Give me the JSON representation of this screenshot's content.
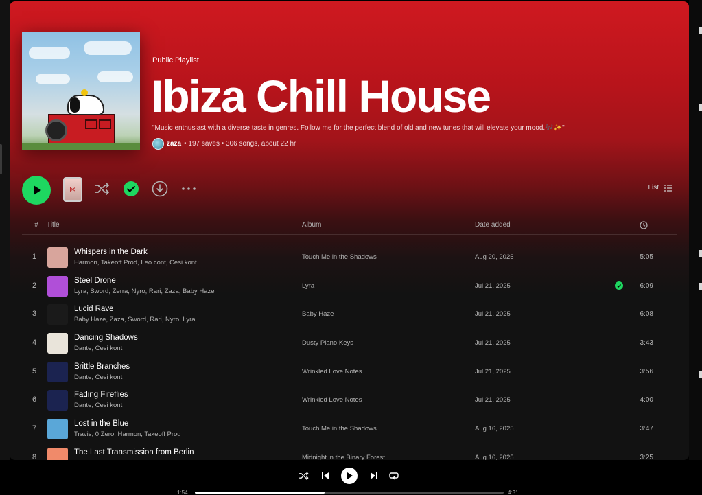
{
  "playlist": {
    "type_label": "Public Playlist",
    "title": "Ibiza Chill House",
    "description": "\"Music enthusiast with a diverse taste in genres. Follow me for the perfect blend of old and new tunes that will elevate your mood.🎶✨\"",
    "owner": "zaza",
    "stats": "• 197 saves • 306 songs, about 22 hr"
  },
  "actions": {
    "play_icon": "play-icon",
    "shuffle_icon": "shuffle-icon",
    "saved_icon": "check-circle-icon",
    "download_icon": "download-icon",
    "more_icon": "more-dots-icon",
    "view_label": "List"
  },
  "table": {
    "headers": {
      "num": "#",
      "title": "Title",
      "album": "Album",
      "date": "Date added",
      "duration_icon": "clock-icon"
    },
    "rows": [
      {
        "num": "1",
        "title": "Whispers in the Dark",
        "artists": "Harmon, Takeoff Prod, Leo cont, Cesi kont",
        "album": "Touch Me in the Shadows",
        "date": "Aug 20, 2025",
        "duration": "5:05",
        "saved": false,
        "thumb_color": "#d8a59c"
      },
      {
        "num": "2",
        "title": "Steel Drone",
        "artists": "Lyra, Sword, Zerra, Nyro, Rari, Zaza, Baby Haze",
        "album": "Lyra",
        "date": "Jul 21, 2025",
        "duration": "6:09",
        "saved": true,
        "thumb_color": "#b04fd8"
      },
      {
        "num": "3",
        "title": "Lucid Rave",
        "artists": "Baby Haze, Zaza, Sword, Rari, Nyro, Lyra",
        "album": "Baby Haze",
        "date": "Jul 21, 2025",
        "duration": "6:08",
        "saved": false,
        "thumb_color": "#1a1a1a"
      },
      {
        "num": "4",
        "title": "Dancing Shadows",
        "artists": "Dante, Cesi kont",
        "album": "Dusty Piano Keys",
        "date": "Jul 21, 2025",
        "duration": "3:43",
        "saved": false,
        "thumb_color": "#e9e4da"
      },
      {
        "num": "5",
        "title": "Brittle Branches",
        "artists": "Dante, Cesi kont",
        "album": "Wrinkled Love Notes",
        "date": "Jul 21, 2025",
        "duration": "3:56",
        "saved": false,
        "thumb_color": "#1b2350"
      },
      {
        "num": "6",
        "title": "Fading Fireflies",
        "artists": "Dante, Cesi kont",
        "album": "Wrinkled Love Notes",
        "date": "Jul 21, 2025",
        "duration": "4:00",
        "saved": false,
        "thumb_color": "#1b2350"
      },
      {
        "num": "7",
        "title": "Lost in the Blue",
        "artists": "Travis, 0 Zero, Harmon, Takeoff Prod",
        "album": "Touch Me in the Shadows",
        "date": "Aug 16, 2025",
        "duration": "3:47",
        "saved": false,
        "thumb_color": "#5aa7d8"
      },
      {
        "num": "8",
        "title": "The Last Transmission from Berlin",
        "artists": "",
        "album": "Midnight in the Binary Forest",
        "date": "Aug 16, 2025",
        "duration": "3:25",
        "saved": false,
        "thumb_color": "#f08a6a"
      }
    ]
  },
  "player": {
    "elapsed": "1:54",
    "total": "4:31",
    "progress_fraction": 0.42
  },
  "colors": {
    "accent": "#1ed760",
    "header_red": "#cf1920",
    "background": "#121212"
  }
}
